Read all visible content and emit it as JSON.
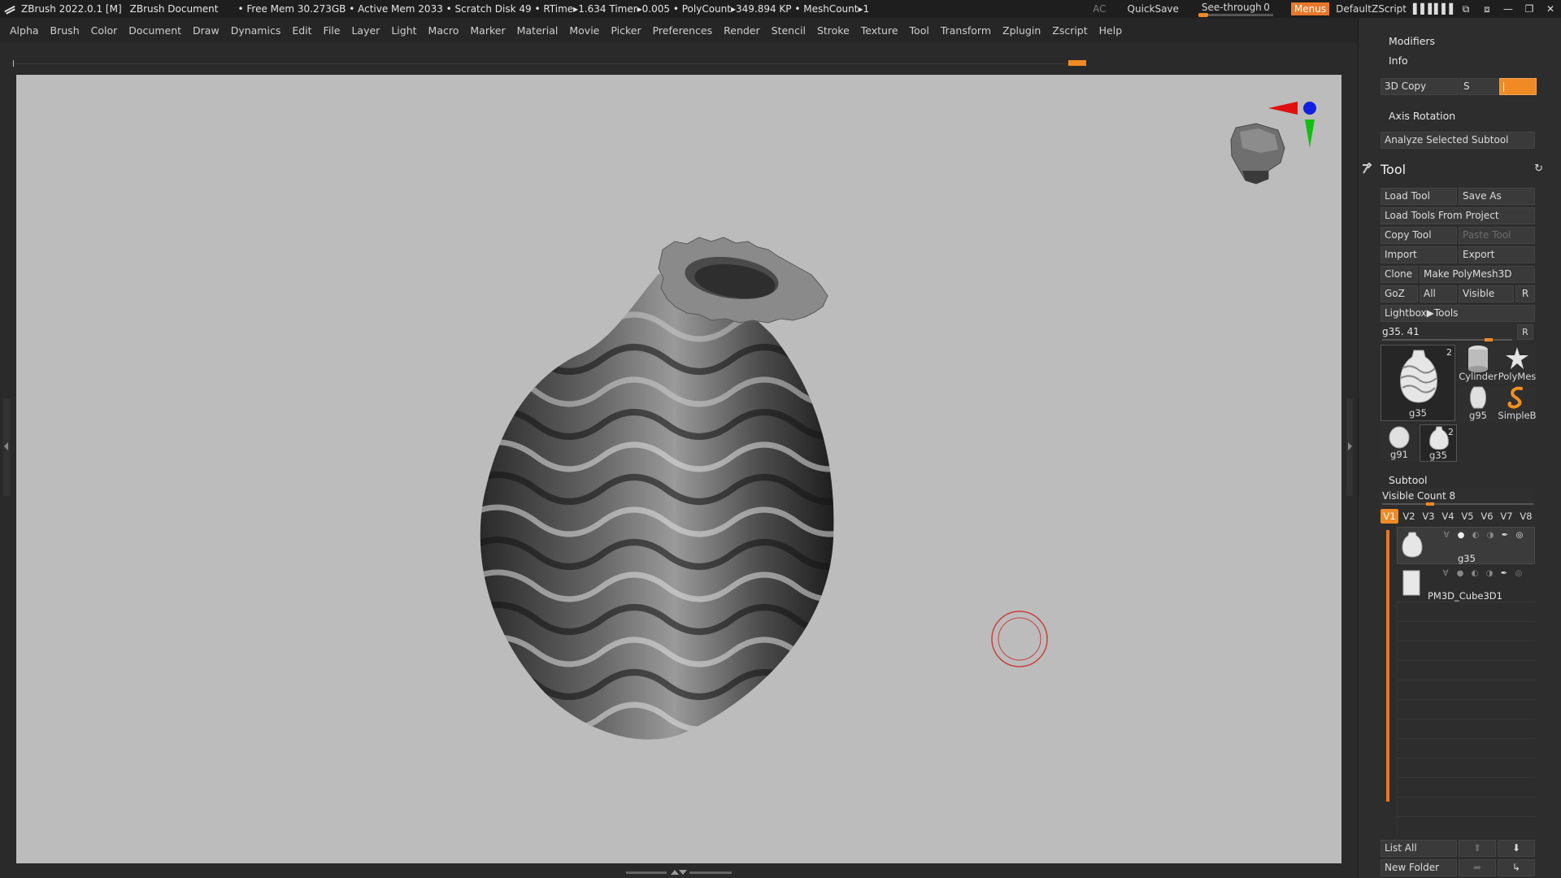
{
  "titlebar": {
    "app": "ZBrush 2022.0.1 [M]",
    "document": "ZBrush Document",
    "stats": "• Free Mem 30.273GB • Active Mem 2033 • Scratch Disk 49 •  RTime▸1.634 Timer▸0.005 • PolyCount▸349.894 KP • MeshCount▸1",
    "ac": "AC",
    "quicksave": "QuickSave",
    "see_through_label": "See-through",
    "see_through_value": "0",
    "see_through_level": 0,
    "menus": "Menus",
    "script": "DefaultZScript"
  },
  "menubar": [
    "Alpha",
    "Brush",
    "Color",
    "Document",
    "Draw",
    "Dynamics",
    "Edit",
    "File",
    "Layer",
    "Light",
    "Macro",
    "Marker",
    "Material",
    "Movie",
    "Picker",
    "Preferences",
    "Render",
    "Stencil",
    "Stroke",
    "Texture",
    "Tool",
    "Transform",
    "Zplugin",
    "Zscript",
    "Help"
  ],
  "panel": {
    "modifiers": "Modifiers",
    "info": "Info",
    "copy3d": "3D Copy",
    "s_label": "S",
    "axis_rotation": "Axis Rotation",
    "analyze": "Analyze Selected Subtool",
    "tool_title": "Tool",
    "load_tool": "Load Tool",
    "save_as": "Save As",
    "load_from_project": "Load Tools From Project",
    "copy_tool": "Copy Tool",
    "paste_tool": "Paste Tool",
    "import": "Import",
    "export": "Export",
    "clone": "Clone",
    "make_polymesh": "Make PolyMesh3D",
    "goz": "GoZ",
    "all": "All",
    "visible": "Visible",
    "r": "R",
    "lightbox": "Lightbox▶Tools",
    "tool_slider_label": "g35. 41",
    "tool_slider_level": 0.72,
    "thumbs": [
      {
        "name": "g35",
        "count": "2"
      },
      {
        "name": "Cylinder",
        "count": ""
      },
      {
        "name": "PolyMes",
        "count": ""
      },
      {
        "name": "g95",
        "count": ""
      },
      {
        "name": "SimpleB",
        "count": ""
      },
      {
        "name": "g91",
        "count": ""
      },
      {
        "name": "g35",
        "count": "2"
      }
    ],
    "subtool": "Subtool",
    "visible_count": "Visible Count 8",
    "vtabs": [
      "V1",
      "V2",
      "V3",
      "V4",
      "V5",
      "V6",
      "V7",
      "V8"
    ],
    "subtools": [
      {
        "name": "g35"
      },
      {
        "name": "PM3D_Cube3D1"
      }
    ],
    "list_all": "List All",
    "new_folder": "New Folder"
  },
  "colors": {
    "accent": "#f08a24",
    "canvas": "#bcbcbc",
    "panel": "#2d2d2d"
  }
}
